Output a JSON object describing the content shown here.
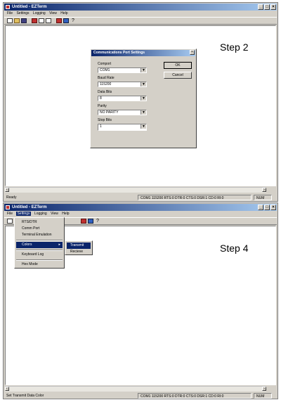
{
  "app": {
    "title": "Untitled - EZTerm"
  },
  "menus": [
    "File",
    "Settings",
    "Logging",
    "View",
    "Help"
  ],
  "step2": {
    "label": "Step 2",
    "dialog": {
      "title": "Communications Port Settings",
      "close": "×",
      "fields": [
        {
          "label": "Comport",
          "value": "COM1"
        },
        {
          "label": "Baud Rate",
          "value": "115200"
        },
        {
          "label": "Data Bits",
          "value": "8"
        },
        {
          "label": "Parity",
          "value": "NO PARITY"
        },
        {
          "label": "Stop Bits",
          "value": "1"
        }
      ],
      "ok": "OK",
      "cancel": "Cancel"
    },
    "status": {
      "left": "Ready",
      "line": "COM1 115200 RTS:0 DTR:0 CTS:0 DSR:1 CD:0 RI:0",
      "num": "NUM"
    }
  },
  "step4": {
    "label": "Step 4",
    "settings_menu": [
      "RTS/DTR",
      "Comm Port",
      "Terminal Emulation",
      "Colors",
      "Keyboard Log",
      "Hex Mode"
    ],
    "colors_submenu": [
      "Transmit",
      "Recieve"
    ],
    "status": {
      "left": "Set Transmit Data Color",
      "line": "COM1 115200 RTS:0 DTR:0 CTS:0 DSR:1 CD:0 RI:0",
      "num": "NUM"
    }
  },
  "window_buttons": {
    "minimize": "_",
    "maximize": "□",
    "close": "×"
  },
  "icons": [
    "new-icon",
    "open-icon",
    "save-icon",
    "connect-icon",
    "settings-icon",
    "log-icon",
    "color-icon",
    "view-icon",
    "help-icon"
  ],
  "colors": {
    "titlebar": "#0a246a",
    "menu_highlight": "#0a246a",
    "face": "#d4d0c8"
  }
}
